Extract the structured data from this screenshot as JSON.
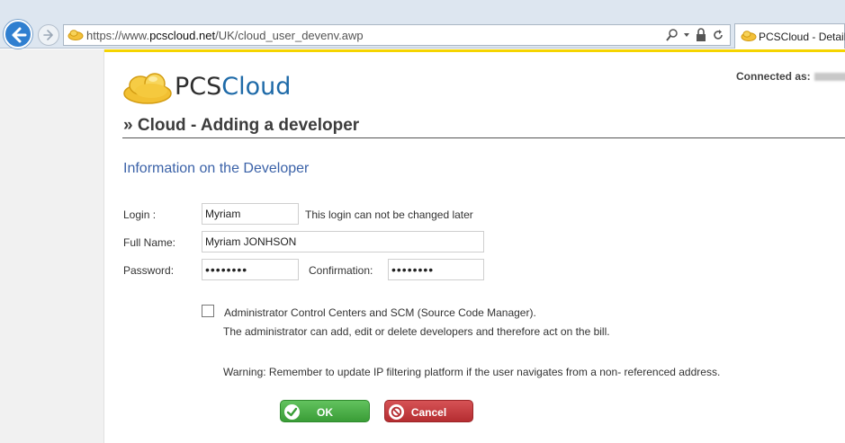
{
  "browser": {
    "url_prefix": "https://www.",
    "url_host": "pcscloud.net",
    "url_path": "/UK/cloud_user_devenv.awp",
    "tab_title": "PCSCloud - Detail"
  },
  "header": {
    "logo_pcs": "PCS",
    "logo_cloud": "Cloud",
    "connected_label": "Connected as:"
  },
  "page": {
    "title": "» Cloud - Adding a developer",
    "section_title": "Information on the Developer"
  },
  "form": {
    "login_label": "Login :",
    "login_value": "Myriam",
    "login_note": "This login can not be changed later",
    "fullname_label": "Full Name:",
    "fullname_value": "Myriam JONHSON",
    "password_label": "Password:",
    "password_value": "••••••••",
    "confirmation_label": "Confirmation:",
    "confirmation_value": "••••••••",
    "admin_label": "Administrator Control Centers and SCM (Source Code Manager).",
    "admin_desc": "The administrator can add, edit or delete developers and therefore act on the bill.",
    "warning": "Warning: Remember to update IP filtering platform if the user navigates from a non- referenced address."
  },
  "buttons": {
    "ok": "OK",
    "cancel": "Cancel"
  },
  "colors": {
    "accent_yellow": "#f5d400",
    "section_blue": "#3b62a8",
    "ok_green": "#4caf48",
    "cancel_red": "#c43a3d"
  }
}
